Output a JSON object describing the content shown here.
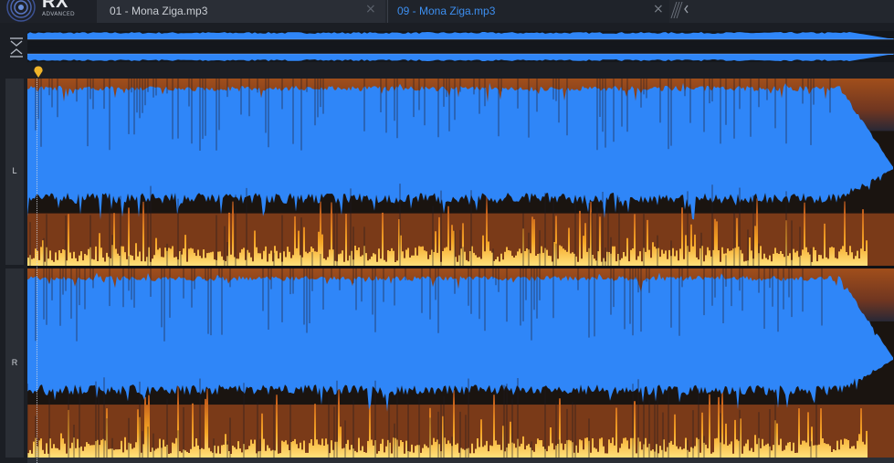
{
  "app": {
    "logo_text": "RX",
    "logo_subtext": "ADVANCED"
  },
  "tabs": [
    {
      "label": "01 - Mona Ziga.mp3",
      "active": false
    },
    {
      "label": "09 - Mona Ziga.mp3",
      "active": true
    }
  ],
  "tab_close_glyph": "×",
  "channels": [
    {
      "label": "L"
    },
    {
      "label": "R"
    }
  ],
  "icons": {
    "collapse": "collapse-overview-icon",
    "playhead": "playhead-marker-icon",
    "tab_overflow": "tab-overflow-icon"
  },
  "colors": {
    "waveform_blue": "#2f86f8",
    "spectrogram_orange": "#f5a524",
    "active_tab_text": "#3d8ff0",
    "playhead": "#f0b429"
  }
}
